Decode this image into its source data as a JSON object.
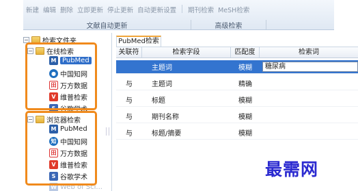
{
  "ribbon": {
    "buttons": [
      "新建",
      "编辑",
      "删除",
      "立即更新",
      "停止更新",
      "自动更新设置",
      "期刊检索",
      "MeSH检索"
    ],
    "group_auto_update": "文献自动更新",
    "group_advanced": "高级检索"
  },
  "tree": {
    "root_label": "检索文件夹",
    "online_folder": "在线检索",
    "online_items": [
      "PubMed",
      "中国知网",
      "万方数据",
      "维普检索",
      "谷歌学术"
    ],
    "browser_folder": "浏览器检索",
    "browser_items": [
      "PubMed",
      "中国知网",
      "万方数据",
      "维普检索",
      "谷歌学术",
      "Web of Sci..."
    ]
  },
  "tab": {
    "label": "PubMed检索"
  },
  "grid": {
    "headers": [
      "关联符",
      "检索字段",
      "匹配度",
      "检索词"
    ],
    "rows": [
      {
        "relation": "",
        "field": "主题词",
        "match": "模糊",
        "term": "糖尿病"
      },
      {
        "relation": "与",
        "field": "主题词",
        "match": "精确",
        "term": ""
      },
      {
        "relation": "与",
        "field": "标题",
        "match": "模糊",
        "term": ""
      },
      {
        "relation": "与",
        "field": "期刊名称",
        "match": "模糊",
        "term": ""
      },
      {
        "relation": "与",
        "field": "标题/摘要",
        "match": "模糊",
        "term": ""
      }
    ]
  },
  "watermark": "最需网",
  "colors": {
    "highlight": "#f08a1c",
    "selection": "#3374cf",
    "watermark": "#2b2ad0"
  }
}
